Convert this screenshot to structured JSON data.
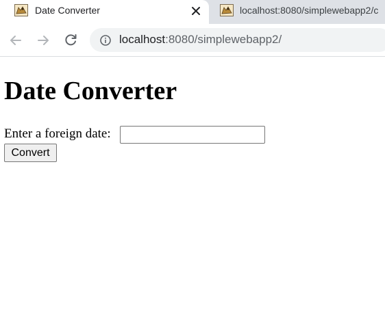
{
  "browser": {
    "tabs": [
      {
        "title": "Date Converter",
        "favicon": "tomcat-icon",
        "active": true
      },
      {
        "title": "localhost:8080/simplewebapp2/c",
        "favicon": "tomcat-icon",
        "active": false
      }
    ],
    "address_bar": {
      "host": "localhost",
      "path": ":8080/simplewebapp2/"
    }
  },
  "page": {
    "heading": "Date Converter",
    "form": {
      "label": "Enter a foreign date:",
      "input_value": "",
      "submit_label": "Convert"
    }
  }
}
